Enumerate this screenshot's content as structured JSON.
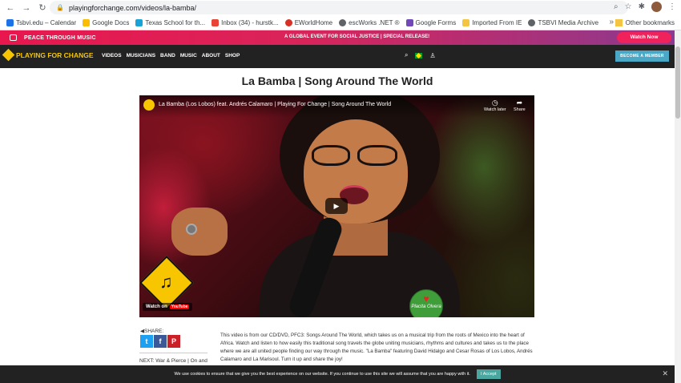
{
  "browser": {
    "url": "playingforchange.com/videos/la-bamba/",
    "bookmarks": [
      {
        "label": "Tsbvi.edu – Calendar",
        "color": "#1a73e8"
      },
      {
        "label": "Google Docs",
        "color": "#4285f4"
      },
      {
        "label": "Texas School for th...",
        "color": "#19a2d6"
      },
      {
        "label": "Inbox (34) - hurstk...",
        "color": "#ea4335"
      },
      {
        "label": "EWorldHome",
        "color": "#d93025"
      },
      {
        "label": "escWorks .NET ®",
        "color": "#5f6368"
      },
      {
        "label": "Google Forms",
        "color": "#7248b9"
      },
      {
        "label": "Imported From IE",
        "color": "#f4c542"
      },
      {
        "label": "TSBVI Media Archive",
        "color": "#5f6368"
      }
    ],
    "other_bookmarks": "Other bookmarks"
  },
  "promo": {
    "left": "PEACE THROUGH MUSIC",
    "center": "A GLOBAL EVENT FOR SOCIAL JUSTICE | SPECIAL RELEASE!",
    "button": "Watch Now"
  },
  "site": {
    "logo_text": "PLAYING FOR CHANGE",
    "menu": [
      "VIDEOS",
      "MUSICIANS",
      "BAND",
      "MUSIC",
      "ABOUT",
      "SHOP"
    ],
    "member_button": "BECOME A MEMBER"
  },
  "page": {
    "title": "La Bamba | Song Around The World"
  },
  "video": {
    "title": "La Bamba (Los Lobos) feat. Andrés Calamaro | Playing For Change | Song Around The World",
    "watch_later": "Watch later",
    "share": "Share",
    "watch_on": "Watch on",
    "youtube": "YouTube",
    "badge_text": "Placita Olvera"
  },
  "share": {
    "label": "SHARE:",
    "next": "NEXT: War & Pierce | On and"
  },
  "description": "This video is from our CD/DVD, PFC3: Songs Around The World, which takes us on a musical trip from the roots of Mexico into the heart of Africa. Watch and listen to how easily this traditional song travels the globe uniting musicians, rhythms and cultures and takes us to the place where we are all united people finding our way through the music. \"La Bamba\" featuring David Hidalgo and Cesar Rosas of Los Lobos, Andrés Calamaro and La Marisoul. Turn it up and share the joy!",
  "cookie": {
    "text": "We use cookies to ensure that we give you the best experience on our website. If you continue to use this site we will assume that you are happy with it.",
    "accept": "I Accept"
  }
}
